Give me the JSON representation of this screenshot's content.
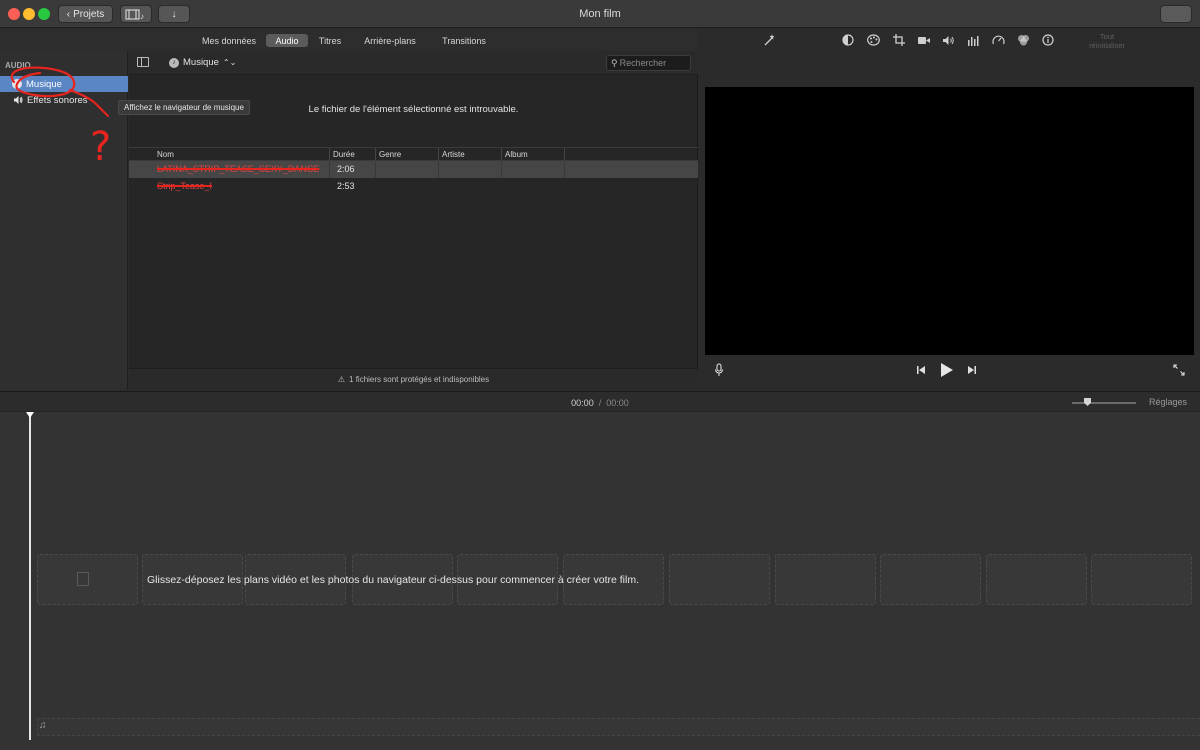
{
  "window": {
    "title": "Mon film"
  },
  "toolbar": {
    "projects_label": "Projets"
  },
  "browser_tabs": [
    "Mes données",
    "Audio",
    "Titres",
    "Arrière-plans",
    "Transitions"
  ],
  "selected_tab": "Audio",
  "sidebar": {
    "heading": "AUDIO",
    "items": [
      {
        "label": "Musique",
        "icon": "music-note-icon",
        "selected": true
      },
      {
        "label": "Effets sonores",
        "icon": "speaker-icon",
        "selected": false
      }
    ]
  },
  "library": {
    "selector_label": "Musique",
    "search_placeholder": "Rechercher",
    "tooltip": "Affichez le navigateur de musique",
    "missing_message": "Le fichier de l'élément sélectionné est introuvable.",
    "columns": [
      "Nom",
      "Durée",
      "Genre",
      "Artiste",
      "Album"
    ],
    "rows": [
      {
        "name": "LATINA_STRIP_TEASE_SEXY_DANCE",
        "duration": "2:06",
        "genre": "",
        "artist": "",
        "album": "",
        "selected": true
      },
      {
        "name": "Strip_Tease_I",
        "duration": "2:53",
        "genre": "",
        "artist": "",
        "album": "",
        "selected": false
      }
    ],
    "footer": "1 fichiers sont protégés et indisponibles"
  },
  "viewer": {
    "reset_label": "Tout réinitialiser",
    "adjust_icons": [
      "magic-wand-icon",
      "color-balance-icon",
      "color-palette-icon",
      "crop-icon",
      "stabilization-icon",
      "volume-icon",
      "equalizer-icon",
      "speed-icon",
      "filter-icon",
      "info-icon"
    ]
  },
  "timeline": {
    "current_time": "00:00",
    "separator": "/",
    "total_time": "00:00",
    "zoom_level": 0.2,
    "settings_label": "Réglages",
    "drop_message": "Glissez-déposez les plans vidéo et les photos du navigateur ci-dessus pour commencer à créer votre film."
  },
  "annotation": {
    "text": "?",
    "color": "#e8241e"
  },
  "colors": {
    "selection": "#5a86c4",
    "annotation": "#e8241e"
  }
}
